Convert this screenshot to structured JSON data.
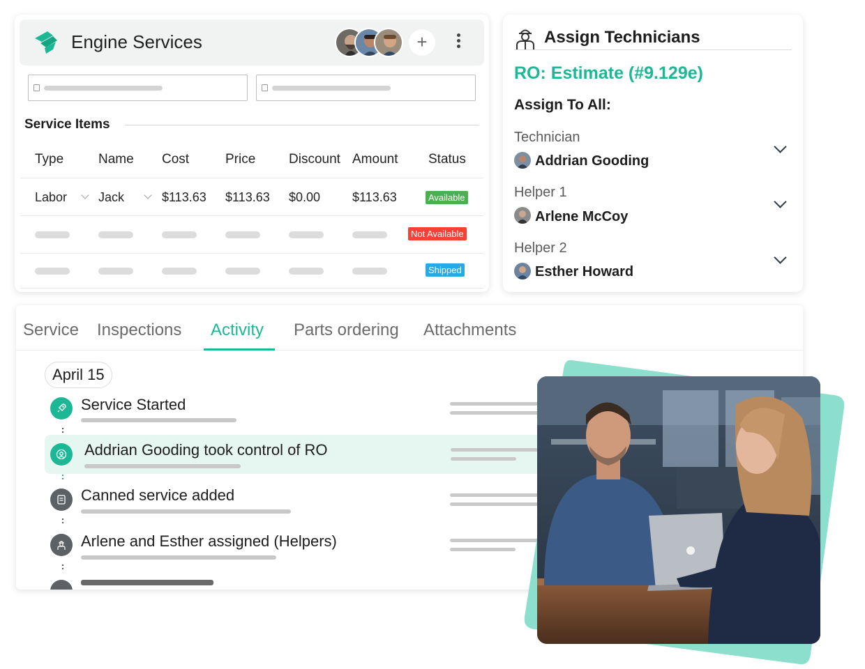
{
  "engine_services": {
    "title": "Engine Services",
    "plus_label": "+",
    "section_title": "Service Items",
    "columns": [
      "Type",
      "Name",
      "Cost",
      "Price",
      "Discount",
      "Amount",
      "Status"
    ],
    "row": {
      "type": "Labor",
      "name": "Jack",
      "cost": "$113.63",
      "price": "$113.63",
      "discount": "$0.00",
      "amount": "$113.63",
      "status": "Available"
    },
    "statuses": [
      "Available",
      "Not Available",
      "Shipped"
    ],
    "status_colors": {
      "available": "#4caf50",
      "not_available": "#f44336",
      "shipped": "#29a9e1"
    }
  },
  "assign": {
    "title": "Assign Technicians",
    "ro_title": "RO: Estimate (#9.129e)",
    "assign_to_all": "Assign To All:",
    "roles": [
      {
        "role": "Technician",
        "name": "Addrian Gooding"
      },
      {
        "role": "Helper 1",
        "name": "Arlene McCoy"
      },
      {
        "role": "Helper 2",
        "name": "Esther Howard"
      }
    ]
  },
  "tabs": [
    "Service",
    "Inspections",
    "Activity",
    "Parts ordering",
    "Attachments"
  ],
  "active_tab": "Activity",
  "activity": {
    "date": "April 15",
    "items": [
      {
        "title": "Service Started",
        "icon": "rocket-icon"
      },
      {
        "title": "Addrian Gooding took control of RO",
        "icon": "user-circle-icon"
      },
      {
        "title": "Canned service added",
        "icon": "document-icon"
      },
      {
        "title": "Arlene and Esther assigned (Helpers)",
        "icon": "technician-icon"
      }
    ]
  },
  "colors": {
    "accent": "#1cb895",
    "accent_light": "#e6f7f2",
    "teal_shape": "#8ddfcd"
  }
}
